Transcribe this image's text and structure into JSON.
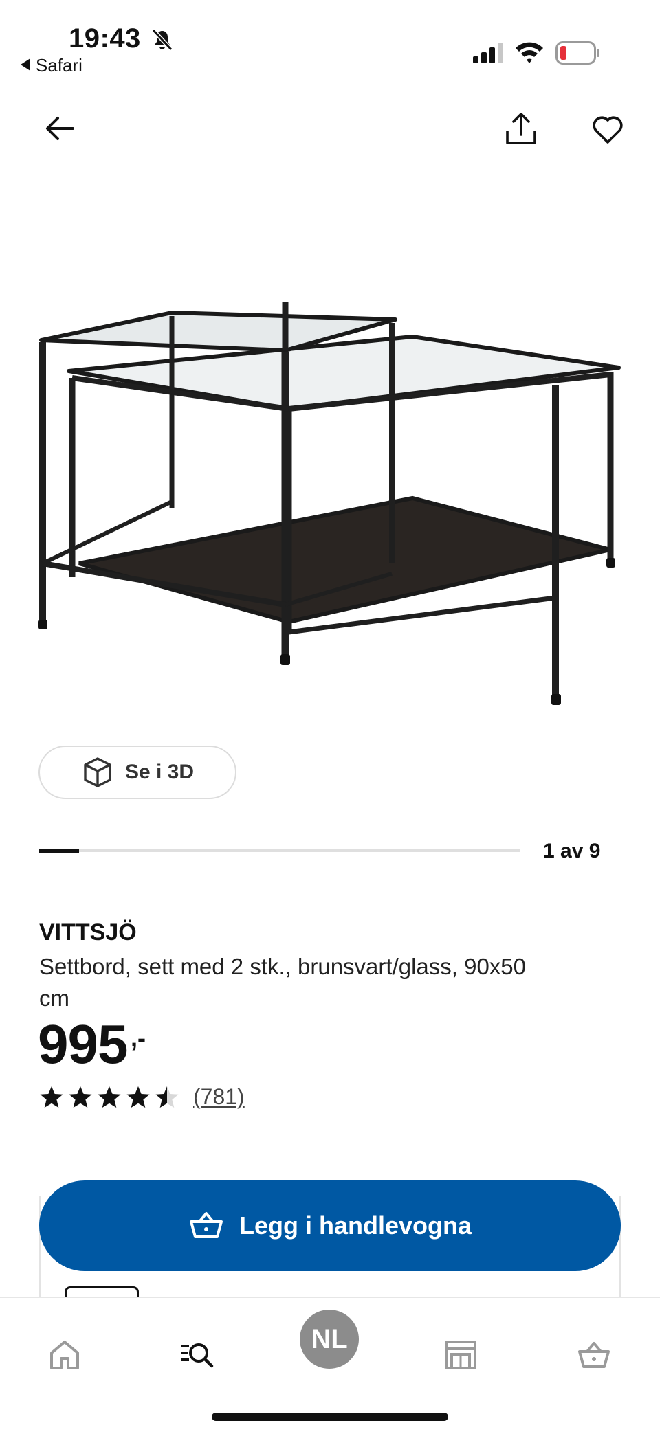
{
  "status_bar": {
    "time": "19:43",
    "back_app": "Safari",
    "battery_level": 0.15
  },
  "product": {
    "name": "VITTSJÖ",
    "description": "Settbord, sett med 2 stk., brunsvart/glass, 90x50 cm",
    "price": "995",
    "price_suffix": ",-",
    "rating": 4.5,
    "rating_count": "(781)"
  },
  "view_3d_label": "Se i 3D",
  "carousel": {
    "progress_text": "1 av 9",
    "current": 1,
    "total": 9
  },
  "cta": {
    "label": "Legg i handlevogna",
    "color": "#0058a3"
  },
  "tab_bar": {
    "avatar_initials": "NL",
    "icons": [
      "home-icon",
      "search-icon",
      "avatar",
      "store-icon",
      "cart-icon"
    ]
  }
}
